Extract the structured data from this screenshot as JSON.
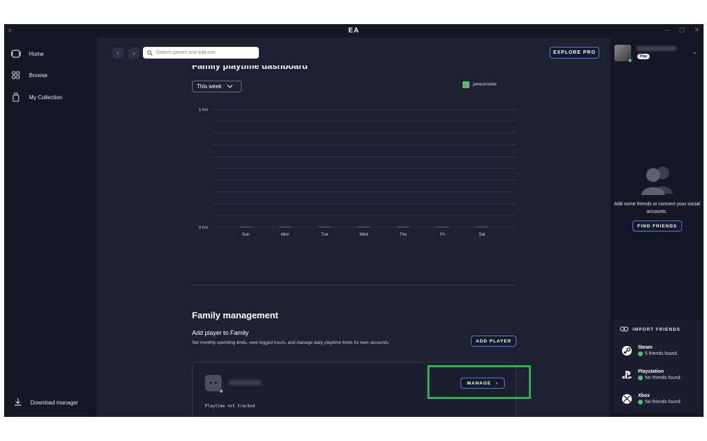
{
  "window": {
    "title": "EA",
    "menu_glyph": "≡",
    "minimize": "–",
    "maximize": "▢",
    "close": "✕"
  },
  "sidebar": {
    "items": [
      {
        "label": "Home",
        "icon": "home-icon"
      },
      {
        "label": "Browse",
        "icon": "grid-icon"
      },
      {
        "label": "My Collection",
        "icon": "collection-icon"
      }
    ],
    "download_manager": "Download manager"
  },
  "topbar": {
    "back": "‹",
    "forward": "›",
    "search_placeholder": "Search games and add-ons",
    "explore_pro": "EXPLORE PRO"
  },
  "dashboard": {
    "title": "Family playtime dashboard",
    "period": "This week",
    "legend": "jamestrouble"
  },
  "chart_data": {
    "type": "bar",
    "categories": [
      "Sun",
      "Mon",
      "Tue",
      "Wed",
      "Thu",
      "Fri",
      "Sat"
    ],
    "series": [
      {
        "name": "jamestrouble",
        "values": [
          0,
          0,
          0,
          0,
          0,
          0,
          0
        ]
      }
    ],
    "y_tick_labels": [
      "0 hrs",
      "1 hrs"
    ],
    "ylim": [
      0,
      1
    ],
    "grid": true,
    "legend_position": "top-right",
    "colors": {
      "series": "#5cb86b",
      "grid": "#333a52",
      "bar": "#4a5068"
    }
  },
  "family": {
    "title": "Family management",
    "add_title": "Add player to Family",
    "add_desc": "Set monthly spending limits, view logged hours, and manage daily playtime limits for teen accounts.",
    "add_button": "ADD PLAYER",
    "player": {
      "playtime_status": "Playtime not tracked",
      "manage_label": "MANAGE",
      "manage_chevron": "›"
    }
  },
  "rightpanel": {
    "profile_badge": "Play",
    "profile_chevron": "⌄",
    "friends_text": "Add some friends or connect your social accounts.",
    "find_friends": "FIND FRIENDS",
    "import_title": "IMPORT FRIENDS",
    "platforms": [
      {
        "name": "Steam",
        "status": "5 friends found",
        "icon": "steam-icon"
      },
      {
        "name": "Playstation",
        "status": "No friends found",
        "icon": "playstation-icon"
      },
      {
        "name": "Xbox",
        "status": "No friends found",
        "icon": "xbox-icon"
      }
    ]
  },
  "colors": {
    "accent": "#5a78d8",
    "highlight": "#2fb24a",
    "online": "#4cc26a"
  }
}
